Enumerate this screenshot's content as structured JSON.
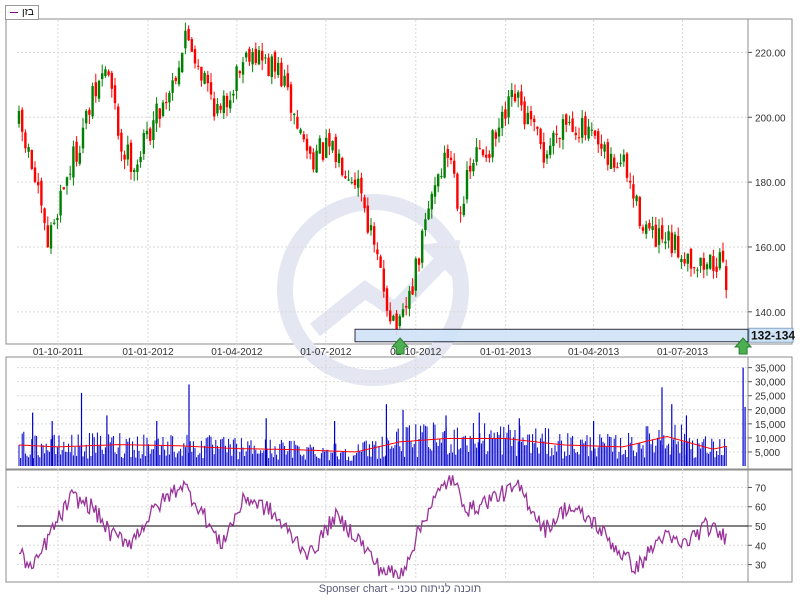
{
  "legend": {
    "series_label": "בזן",
    "line_color": "#800080"
  },
  "footer": {
    "text": "Sponser chart - תוכנה לניתוח טכני"
  },
  "support": {
    "label": "132-134",
    "color": "#cfe3f7"
  },
  "colors": {
    "up": "#008000",
    "down": "#ff0000",
    "volume": "#0000cc",
    "volume_ma": "#ff0000",
    "rsi": "#993399",
    "grid": "#d9d9d9"
  },
  "chart_data": [
    {
      "type": "candlestick",
      "x_tick_labels": [
        "01-10-2011",
        "01-01-2012",
        "01-04-2012",
        "01-07-2012",
        "01-10-2012",
        "01-01-2013",
        "01-04-2013",
        "01-07-2013"
      ],
      "y_tick_labels": [
        "220.00",
        "200.00",
        "180.00",
        "160.00",
        "140.00"
      ],
      "ylim": [
        131,
        230
      ],
      "grid": true,
      "annotations": [
        "132-134"
      ],
      "close_series": [
        {
          "x": "2011-08-20",
          "y": 200
        },
        {
          "x": "2011-09-05",
          "y": 184
        },
        {
          "x": "2011-09-20",
          "y": 160
        },
        {
          "x": "2011-10-05",
          "y": 178
        },
        {
          "x": "2011-10-20",
          "y": 190
        },
        {
          "x": "2011-11-05",
          "y": 205
        },
        {
          "x": "2011-11-20",
          "y": 216
        },
        {
          "x": "2011-12-05",
          "y": 190
        },
        {
          "x": "2011-12-20",
          "y": 186
        },
        {
          "x": "2012-01-05",
          "y": 198
        },
        {
          "x": "2012-01-25",
          "y": 210
        },
        {
          "x": "2012-02-10",
          "y": 226
        },
        {
          "x": "2012-02-25",
          "y": 214
        },
        {
          "x": "2012-03-15",
          "y": 200
        },
        {
          "x": "2012-04-01",
          "y": 214
        },
        {
          "x": "2012-04-15",
          "y": 222
        },
        {
          "x": "2012-05-01",
          "y": 216
        },
        {
          "x": "2012-05-15",
          "y": 214
        },
        {
          "x": "2012-06-01",
          "y": 198
        },
        {
          "x": "2012-06-15",
          "y": 188
        },
        {
          "x": "2012-07-01",
          "y": 190
        },
        {
          "x": "2012-07-20",
          "y": 186
        },
        {
          "x": "2012-08-05",
          "y": 180
        },
        {
          "x": "2012-08-20",
          "y": 158
        },
        {
          "x": "2012-09-05",
          "y": 140
        },
        {
          "x": "2012-09-15",
          "y": 134
        },
        {
          "x": "2012-10-01",
          "y": 152
        },
        {
          "x": "2012-10-20",
          "y": 180
        },
        {
          "x": "2012-11-05",
          "y": 190
        },
        {
          "x": "2012-11-15",
          "y": 172
        },
        {
          "x": "2012-12-01",
          "y": 188
        },
        {
          "x": "2012-12-20",
          "y": 192
        },
        {
          "x": "2013-01-10",
          "y": 206
        },
        {
          "x": "2013-01-25",
          "y": 198
        },
        {
          "x": "2013-02-10",
          "y": 188
        },
        {
          "x": "2013-03-01",
          "y": 200
        },
        {
          "x": "2013-03-15",
          "y": 198
        },
        {
          "x": "2013-04-01",
          "y": 192
        },
        {
          "x": "2013-04-15",
          "y": 186
        },
        {
          "x": "2013-05-01",
          "y": 186
        },
        {
          "x": "2013-05-15",
          "y": 172
        },
        {
          "x": "2013-06-01",
          "y": 162
        },
        {
          "x": "2013-06-20",
          "y": 160
        },
        {
          "x": "2013-07-05",
          "y": 158
        },
        {
          "x": "2013-07-20",
          "y": 154
        },
        {
          "x": "2013-08-05",
          "y": 156
        },
        {
          "x": "2013-08-20",
          "y": 146
        },
        {
          "x": "2013-09-01",
          "y": 138
        },
        {
          "x": "2013-09-05",
          "y": 136
        }
      ]
    },
    {
      "type": "bar",
      "y_tick_labels": [
        "35,000",
        "30,000",
        "25,000",
        "20,000",
        "15,000",
        "10,000",
        "5,000"
      ],
      "ylim": [
        0,
        37000
      ],
      "grid": true,
      "spikes": [
        {
          "x": "2011-09-05",
          "y": 19000
        },
        {
          "x": "2011-09-25",
          "y": 16000
        },
        {
          "x": "2011-10-25",
          "y": 26000
        },
        {
          "x": "2011-11-20",
          "y": 18000
        },
        {
          "x": "2012-01-10",
          "y": 16000
        },
        {
          "x": "2012-02-12",
          "y": 29000
        },
        {
          "x": "2012-05-01",
          "y": 17000
        },
        {
          "x": "2012-07-10",
          "y": 16000
        },
        {
          "x": "2012-09-01",
          "y": 22000
        },
        {
          "x": "2012-09-18",
          "y": 20000
        },
        {
          "x": "2012-11-01",
          "y": 18000
        },
        {
          "x": "2012-12-05",
          "y": 19000
        },
        {
          "x": "2013-01-15",
          "y": 17000
        },
        {
          "x": "2013-04-01",
          "y": 16000
        },
        {
          "x": "2013-06-10",
          "y": 28000
        },
        {
          "x": "2013-06-20",
          "y": 22000
        },
        {
          "x": "2013-07-05",
          "y": 18000
        },
        {
          "x": "2013-09-01",
          "y": 35000
        },
        {
          "x": "2013-09-03",
          "y": 21000
        }
      ],
      "moving_average": [
        {
          "x": "2011-08-20",
          "y": 7500
        },
        {
          "x": "2011-10-01",
          "y": 6800
        },
        {
          "x": "2011-12-01",
          "y": 7600
        },
        {
          "x": "2012-02-01",
          "y": 7200
        },
        {
          "x": "2012-04-01",
          "y": 6200
        },
        {
          "x": "2012-06-01",
          "y": 5800
        },
        {
          "x": "2012-08-01",
          "y": 5000
        },
        {
          "x": "2012-09-15",
          "y": 8600
        },
        {
          "x": "2012-11-01",
          "y": 9800
        },
        {
          "x": "2013-01-01",
          "y": 9800
        },
        {
          "x": "2013-03-01",
          "y": 7500
        },
        {
          "x": "2013-05-01",
          "y": 6800
        },
        {
          "x": "2013-06-15",
          "y": 10500
        },
        {
          "x": "2013-08-01",
          "y": 6000
        },
        {
          "x": "2013-09-05",
          "y": 8500
        }
      ]
    },
    {
      "type": "line",
      "y_tick_labels": [
        "70",
        "60",
        "50",
        "40",
        "30"
      ],
      "ylim": [
        22,
        78
      ],
      "reference_line": 50,
      "grid": true,
      "values": [
        {
          "x": "2011-08-20",
          "y": 38
        },
        {
          "x": "2011-09-05",
          "y": 27
        },
        {
          "x": "2011-09-25",
          "y": 48
        },
        {
          "x": "2011-10-15",
          "y": 65
        },
        {
          "x": "2011-11-05",
          "y": 60
        },
        {
          "x": "2011-11-25",
          "y": 45
        },
        {
          "x": "2011-12-15",
          "y": 42
        },
        {
          "x": "2012-01-10",
          "y": 60
        },
        {
          "x": "2012-02-05",
          "y": 72
        },
        {
          "x": "2012-02-25",
          "y": 58
        },
        {
          "x": "2012-03-15",
          "y": 40
        },
        {
          "x": "2012-04-10",
          "y": 65
        },
        {
          "x": "2012-05-05",
          "y": 58
        },
        {
          "x": "2012-05-25",
          "y": 46
        },
        {
          "x": "2012-06-15",
          "y": 35
        },
        {
          "x": "2012-07-10",
          "y": 55
        },
        {
          "x": "2012-08-01",
          "y": 45
        },
        {
          "x": "2012-08-25",
          "y": 28
        },
        {
          "x": "2012-09-15",
          "y": 24
        },
        {
          "x": "2012-10-15",
          "y": 60
        },
        {
          "x": "2012-11-05",
          "y": 75
        },
        {
          "x": "2012-11-25",
          "y": 58
        },
        {
          "x": "2012-12-20",
          "y": 65
        },
        {
          "x": "2013-01-15",
          "y": 70
        },
        {
          "x": "2013-02-10",
          "y": 48
        },
        {
          "x": "2013-03-05",
          "y": 60
        },
        {
          "x": "2013-04-01",
          "y": 52
        },
        {
          "x": "2013-04-25",
          "y": 38
        },
        {
          "x": "2013-05-15",
          "y": 28
        },
        {
          "x": "2013-06-10",
          "y": 45
        },
        {
          "x": "2013-07-01",
          "y": 40
        },
        {
          "x": "2013-07-25",
          "y": 50
        },
        {
          "x": "2013-08-15",
          "y": 44
        },
        {
          "x": "2013-09-01",
          "y": 36
        },
        {
          "x": "2013-09-05",
          "y": 33
        }
      ]
    }
  ]
}
